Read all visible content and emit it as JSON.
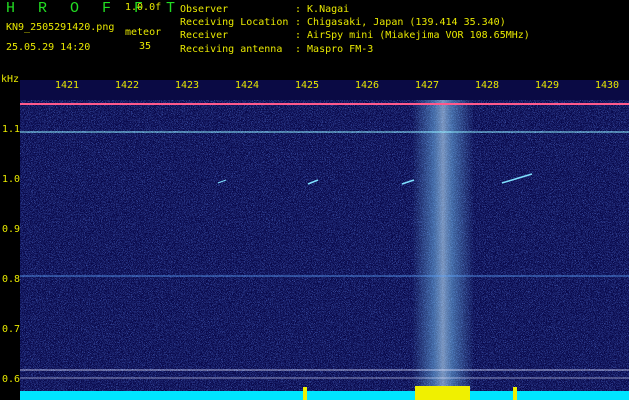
{
  "app": {
    "title": "H R O F F T",
    "version": "1.0.0f",
    "filename": "KN9_2505291420.png",
    "datetime": "25.05.29 14:20",
    "meteor_label": "meteor",
    "meteor_count": "35"
  },
  "info": [
    {
      "label": "Observer",
      "value": ": K.Nagai"
    },
    {
      "label": "Receiving Location",
      "value": ": Chigasaki, Japan (139.414 35.340)"
    },
    {
      "label": "Receiver",
      "value": ": AirSpy mini (Miakejima VOR 108.65MHz)"
    },
    {
      "label": "Receiving antenna",
      "value": ": Maspro FM-3"
    }
  ],
  "axis": {
    "unit": "kHz",
    "x_ticks": [
      "1421",
      "1422",
      "1423",
      "1424",
      "1425",
      "1426",
      "1427",
      "1428",
      "1429",
      "1430"
    ],
    "y_ticks": [
      "1.1",
      "1.0",
      "0.9",
      "0.8",
      "0.7",
      "0.6"
    ]
  },
  "colors": {
    "background": "#08084a",
    "noise": "#2a3fd6",
    "carrier_band": "#7fd0ff",
    "text": "#e8e800",
    "title": "#22dd22",
    "bottom_strip": "#00e5ff"
  }
}
